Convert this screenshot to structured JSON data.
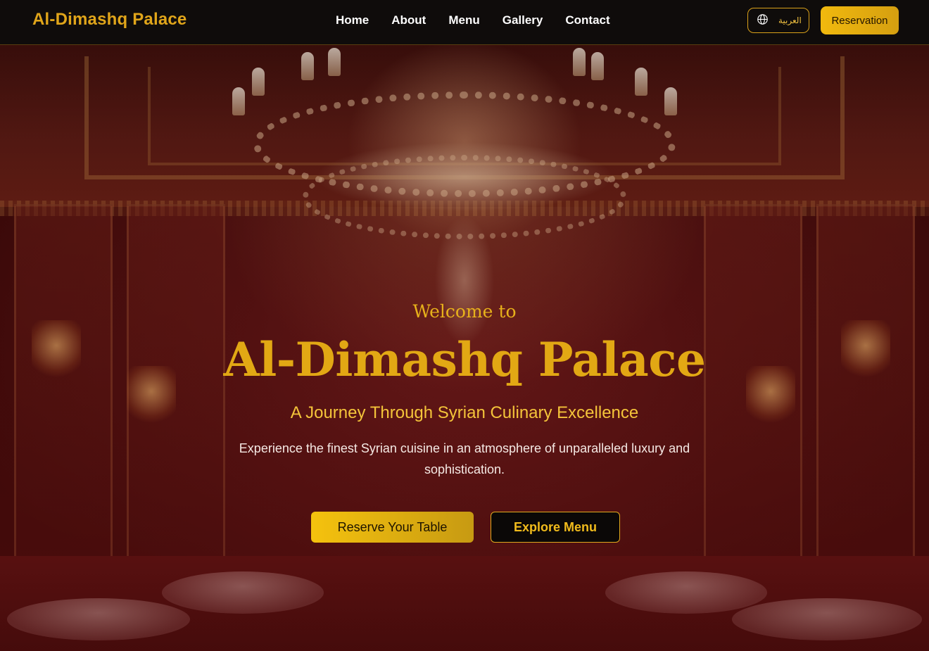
{
  "brand": {
    "name": "Al-Dimashq Palace",
    "accent": "#e0a51a"
  },
  "nav": {
    "items": [
      {
        "label": "Home"
      },
      {
        "label": "About"
      },
      {
        "label": "Menu"
      },
      {
        "label": "Gallery"
      },
      {
        "label": "Contact"
      }
    ]
  },
  "header_actions": {
    "language_icon": "globe-icon",
    "language_label": "العربية",
    "reservation_label": "Reservation"
  },
  "hero": {
    "welcome": "Welcome to",
    "title": "Al-Dimashq Palace",
    "subtitle": "A Journey Through Syrian Culinary Excellence",
    "description": "Experience the finest Syrian cuisine in an atmosphere of unparalleled luxury and sophistication.",
    "primary_cta": "Reserve Your Table",
    "secondary_cta": "Explore Menu"
  },
  "colors": {
    "gold": "#e2a814",
    "header_bg": "#0f0c0b",
    "hero_tint": "#6e1e1e"
  }
}
